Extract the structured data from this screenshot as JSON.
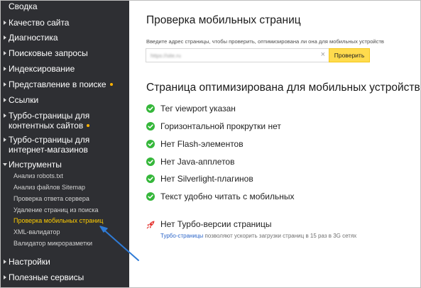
{
  "sidebar": {
    "summary": "Сводка",
    "items": [
      {
        "label": "Качество сайта"
      },
      {
        "label": "Диагностика"
      },
      {
        "label": "Поисковые запросы"
      },
      {
        "label": "Индексирование"
      },
      {
        "label": "Представление в поиске",
        "dot": true
      },
      {
        "label": "Ссылки"
      },
      {
        "label_line1": "Турбо-страницы для",
        "label_line2": "контентных сайтов",
        "dot": true
      },
      {
        "label_line1": "Турбо-страницы для",
        "label_line2": "интернет-магазинов"
      },
      {
        "label": "Инструменты",
        "expanded": true
      },
      {
        "label": "Настройки"
      },
      {
        "label": "Полезные сервисы"
      }
    ],
    "tools": [
      "Анализ robots.txt",
      "Анализ файлов Sitemap",
      "Проверка ответа сервера",
      "Удаление страниц из поиска",
      "Проверка мобильных страниц",
      "XML-валидатор",
      "Валидатор микроразметки"
    ],
    "active_tool": "Проверка мобильных страниц",
    "dot_color": "#ffb300",
    "active_color": "#ffcc00"
  },
  "main": {
    "title": "Проверка мобильных страниц",
    "hint": "Введите адрес страницы, чтобы проверить, оптимизирована ли она для мобильных устройств",
    "url_value": "https://site.ru",
    "clear_icon": "close-icon",
    "check_button": "Проверить",
    "result_title": "Страница оптимизирована для мобильных устройств",
    "checks": [
      "Тег viewport указан",
      "Горизонтальной прокрутки нет",
      "Нет Flash-элементов",
      "Нет Java-апплетов",
      "Нет Silverlight-плагинов",
      "Текст удобно читать с мобильных"
    ],
    "ok_color": "#35b73a",
    "turbo_warning": "Нет Турбо-версии страницы",
    "turbo_link": "Турбо-страницы",
    "turbo_note": " позволяют ускорить загрузки страниц в 15 раз в 3G сетях"
  }
}
